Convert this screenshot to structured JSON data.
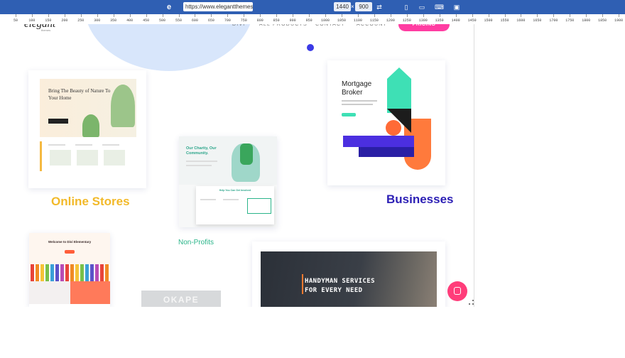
{
  "toolbar": {
    "url": "https://www.elegantthemes.com",
    "width": "1440",
    "height": "900",
    "times": "×"
  },
  "ruler": {
    "ticks": [
      "50",
      "100",
      "150",
      "200",
      "250",
      "300",
      "350",
      "400",
      "450",
      "500",
      "550",
      "600",
      "650",
      "700",
      "750",
      "800",
      "850",
      "900",
      "950",
      "1000",
      "1050",
      "1100",
      "1150",
      "1200",
      "1250",
      "1300",
      "1350",
      "1400",
      "1450",
      "1500",
      "1550",
      "1600",
      "1650",
      "1700",
      "1750",
      "1800",
      "1850",
      "1900"
    ]
  },
  "site": {
    "logo": "elegant",
    "logo_sub": "themes",
    "nav": [
      "DIVI",
      "ALL PRODUCTS",
      "CONTACT",
      "ACCOUNT"
    ],
    "pricing": "PRICING"
  },
  "cards": {
    "online_store_title": "Bring The Beauty of Nature To Your Home",
    "online_store_label": "Online Stores",
    "nonprofit_title": "Our Charity, Our Community.",
    "nonprofit_panel": "Help You Can Get Involved",
    "nonprofit_label": "Non-Profits",
    "business_title": "Mortgage Broker",
    "business_label": "Businesses",
    "elementary_title": "Welcome to Divi Elementary",
    "okape": "OKAPE",
    "handyman_title": "HANDYMAN SERVICES FOR EVERY NEED"
  },
  "colors": {
    "toolbar": "#2f5fb3",
    "pricing": "#ff3da2",
    "online_store": "#f2b929",
    "nonprofit": "#2bb58a",
    "business": "#2c1fb5",
    "chat": "#ff3d7a"
  },
  "icons": {
    "toolbar_logo": "elegant-e-icon",
    "rotate": "rotate-icon",
    "phone": "phone-icon",
    "tablet": "tablet-icon",
    "laptop": "laptop-icon",
    "desktop": "desktop-icon",
    "chat": "chat-icon"
  }
}
